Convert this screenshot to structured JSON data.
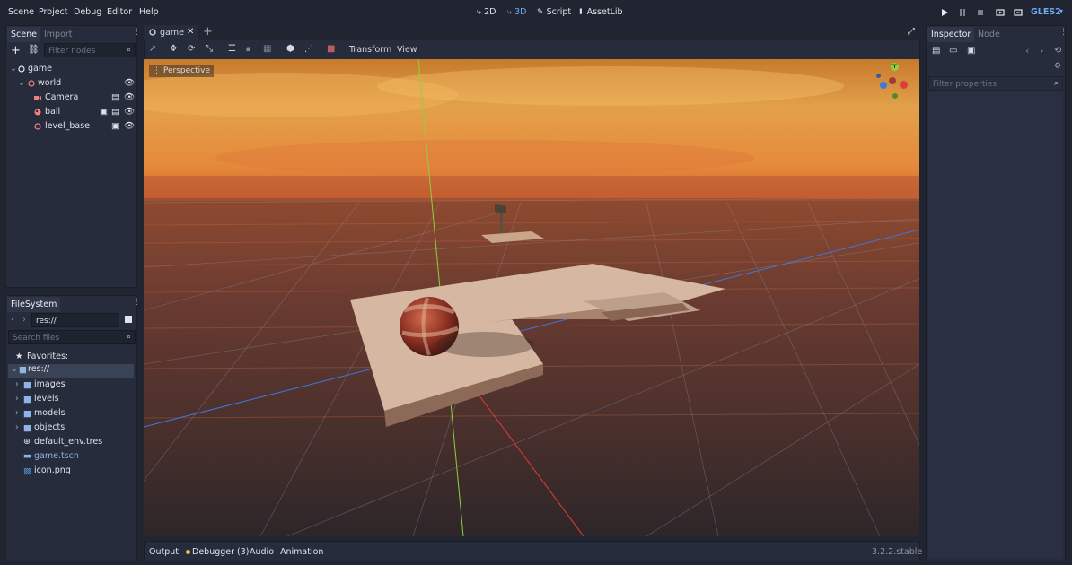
{
  "menu": [
    "Scene",
    "Project",
    "Debug",
    "Editor",
    "Help"
  ],
  "workspace": {
    "2d": "2D",
    "3d": "3D",
    "script": "Script",
    "assetlib": "AssetLib"
  },
  "renderer": "GLES2",
  "scene_dock": {
    "tabs": [
      "Scene",
      "Import"
    ],
    "filter_placeholder": "Filter nodes",
    "nodes": [
      {
        "label": "game",
        "icon": "spatial-node-icon"
      },
      {
        "label": "world",
        "icon": "spatial-node-icon"
      },
      {
        "label": "Camera",
        "icon": "camera-icon"
      },
      {
        "label": "ball",
        "icon": "rigidbody-icon"
      },
      {
        "label": "level_base",
        "icon": "spatial-node-icon"
      }
    ]
  },
  "filesystem": {
    "tab": "FileSystem",
    "path": "res://",
    "search_placeholder": "Search files",
    "favorites": "Favorites:",
    "root": "res://",
    "folders": [
      "images",
      "levels",
      "models",
      "objects"
    ],
    "files": [
      "default_env.tres",
      "game.tscn",
      "icon.png"
    ]
  },
  "editor_tabs": [
    {
      "label": "game"
    }
  ],
  "viewport_toolbar": {
    "transform": "Transform",
    "view": "View"
  },
  "viewport": {
    "perspective_label": "Perspective",
    "gizmo_y": "Y"
  },
  "inspector": {
    "tabs": [
      "Inspector",
      "Node"
    ],
    "filter_placeholder": "Filter properties"
  },
  "bottom": {
    "output": "Output",
    "debugger": "Debugger (3)",
    "audio": "Audio",
    "animation": "Animation",
    "version": "3.2.2.stable"
  },
  "colors": {
    "accent": "#6ea8f5",
    "panel": "#262c3b",
    "background": "#202531",
    "debugger_dot": "#e6c14a",
    "axis_x": "#e03c3c",
    "axis_y": "#8bd23c",
    "axis_z": "#3c78e0"
  }
}
